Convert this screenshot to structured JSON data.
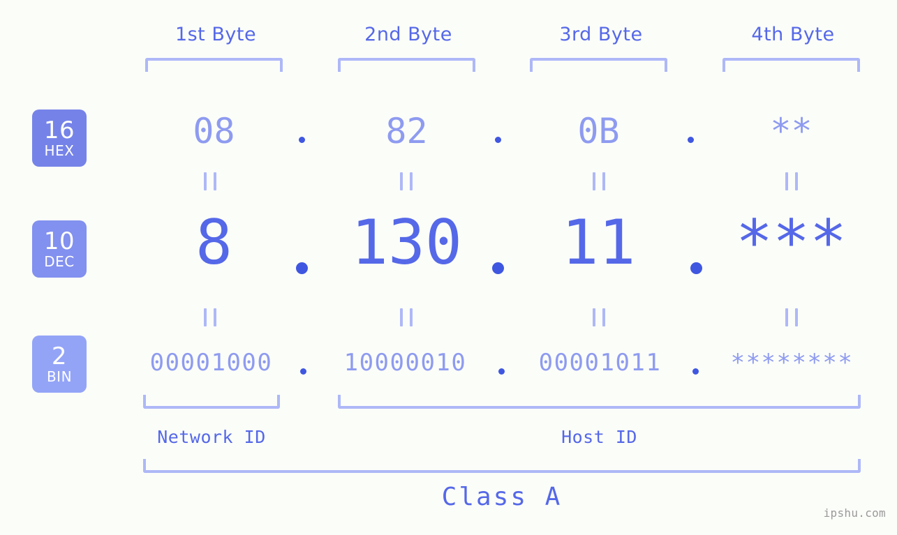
{
  "meta": {
    "background_color": "#fbfdf9",
    "accent_color": "#5568e8",
    "accent_light_color": "#8e9bf0",
    "bracket_color": "#aeb8f7",
    "watermark": "ipshu.com"
  },
  "byte_headers": [
    {
      "label": "1st Byte"
    },
    {
      "label": "2nd Byte"
    },
    {
      "label": "3rd Byte"
    },
    {
      "label": "4th Byte"
    }
  ],
  "rows": [
    {
      "key": "hex",
      "badge_number": "16",
      "badge_name": "HEX",
      "badge_color": "#7583e8",
      "values": [
        "08",
        "82",
        "0B",
        "**"
      ],
      "separator": "."
    },
    {
      "key": "dec",
      "badge_number": "10",
      "badge_name": "DEC",
      "badge_color": "#8290ef",
      "values": [
        "8",
        "130",
        "11",
        "***"
      ],
      "separator": "."
    },
    {
      "key": "bin",
      "badge_number": "2",
      "badge_name": "BIN",
      "badge_color": "#93a4f7",
      "values": [
        "00001000",
        "10000010",
        "00001011",
        "********"
      ],
      "separator": "."
    }
  ],
  "equality_marks": {
    "symbol": "=",
    "count_per_gap": 4,
    "gaps": 2
  },
  "id_sections": [
    {
      "label": "Network ID"
    },
    {
      "label": "Host ID"
    }
  ],
  "class_section": {
    "label": "Class A"
  }
}
